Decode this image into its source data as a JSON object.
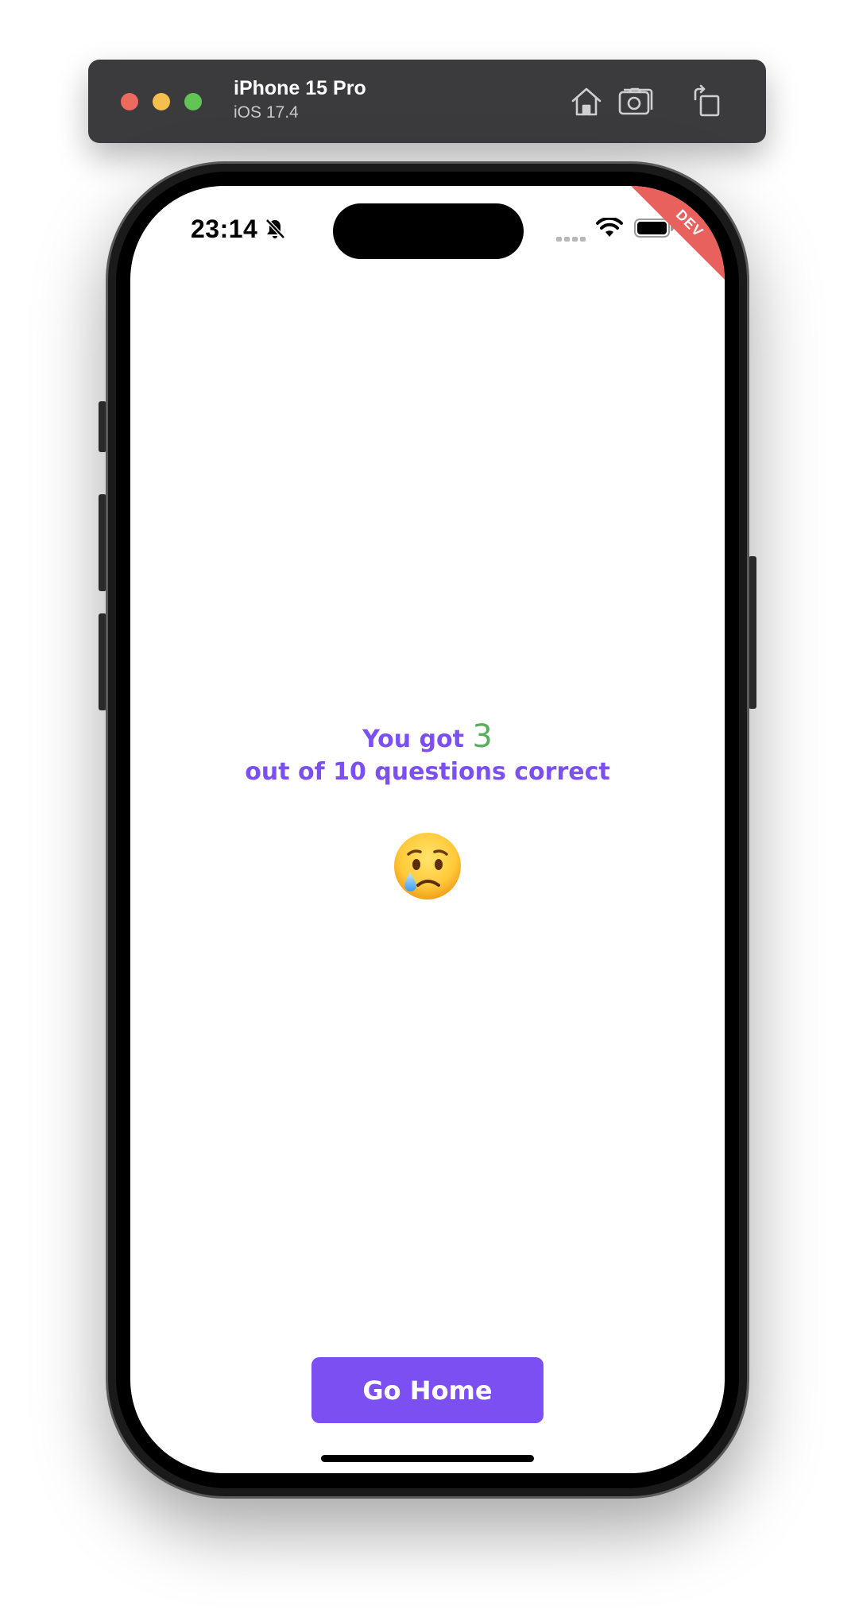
{
  "toolbar": {
    "device_name": "iPhone 15 Pro",
    "os_version": "iOS 17.4",
    "icons": [
      "home-icon",
      "screenshot-icon",
      "rotate-icon"
    ]
  },
  "status_bar": {
    "time": "23:14",
    "icons": [
      "bell-slash-icon",
      "signal-icon",
      "wifi-icon",
      "battery-icon"
    ]
  },
  "banner": {
    "label": "DEV",
    "color": "#e8615d"
  },
  "result": {
    "prefix": "You got",
    "score": "3",
    "suffix": "out of 10 questions correct",
    "emoji_icon": "crying-face-icon",
    "text_color": "#7b4ff2",
    "score_color": "#59ae5a"
  },
  "actions": {
    "go_home_label": "Go Home",
    "button_color": "#7b4ff2"
  }
}
